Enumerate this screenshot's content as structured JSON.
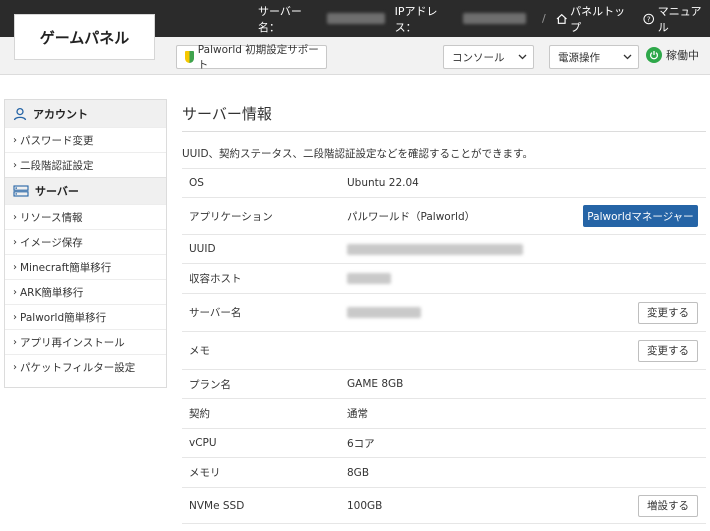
{
  "header": {
    "logo": "ゲームパネル",
    "server_name_label": "サーバー名：",
    "ip_label": "IPアドレス：",
    "panel_top": "パネルトップ",
    "manual": "マニュアル"
  },
  "toolbar": {
    "support_button": "Palworld 初期設定サポート",
    "console_select": "コンソール",
    "power_select": "電源操作",
    "status": "稼働中"
  },
  "sidebar": {
    "account_heading": "アカウント",
    "account_items": [
      "パスワード変更",
      "二段階認証設定"
    ],
    "server_heading": "サーバー",
    "server_items": [
      "リソース情報",
      "イメージ保存",
      "Minecraft簡単移行",
      "ARK簡単移行",
      "Palworld簡単移行",
      "アプリ再インストール",
      "パケットフィルター設定"
    ]
  },
  "main": {
    "title": "サーバー情報",
    "description": "UUID、契約ステータス、二段階認証設定などを確認することができます。",
    "rows": [
      {
        "key": "OS",
        "value": "Ubuntu 22.04"
      },
      {
        "key": "アプリケーション",
        "value": "パルワールド（Palworld）",
        "button": "Palworldマネージャー"
      },
      {
        "key": "UUID",
        "value": ""
      },
      {
        "key": "収容ホスト",
        "value": ""
      },
      {
        "key": "サーバー名",
        "value": "",
        "button": "変更する"
      },
      {
        "key": "メモ",
        "value": "",
        "button": "変更する"
      },
      {
        "key": "プラン名",
        "value": "GAME 8GB"
      },
      {
        "key": "契約",
        "value": "通常"
      },
      {
        "key": "vCPU",
        "value": "6コア"
      },
      {
        "key": "メモリ",
        "value": "8GB"
      },
      {
        "key": "NVMe SSD",
        "value": "100GB",
        "button": "増設する"
      }
    ]
  },
  "colors": {
    "header_bg": "#2b2b2b",
    "primary_button": "#2564a6",
    "status_green": "#2ea84a"
  }
}
